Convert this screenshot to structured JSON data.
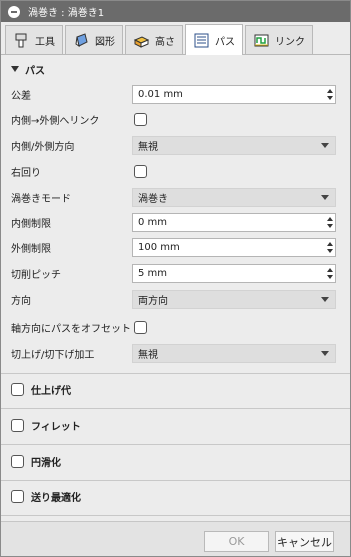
{
  "window": {
    "title": "渦巻き : 渦巻き1"
  },
  "tabs": [
    {
      "label": "工具",
      "icon": "tool-icon"
    },
    {
      "label": "図形",
      "icon": "geometry-icon"
    },
    {
      "label": "高さ",
      "icon": "heights-icon"
    },
    {
      "label": "パス",
      "icon": "passes-icon",
      "active": true
    },
    {
      "label": "リンク",
      "icon": "linking-icon"
    }
  ],
  "passes": {
    "section_label": "パス",
    "tolerance": {
      "label": "公差",
      "value": "0.01 mm"
    },
    "inside_out_link": {
      "label": "内側→外側へリンク",
      "checked": false
    },
    "inside_out_direction": {
      "label": "内側/外側方向",
      "value": "無視"
    },
    "clockwise": {
      "label": "右回り",
      "checked": false
    },
    "spiral_mode": {
      "label": "渦巻きモード",
      "value": "渦巻き"
    },
    "inner_limit": {
      "label": "内側制限",
      "value": "0 mm"
    },
    "outer_limit": {
      "label": "外側制限",
      "value": "100 mm"
    },
    "stepover": {
      "label": "切削ピッチ",
      "value": "5 mm"
    },
    "direction": {
      "label": "方向",
      "value": "両方向"
    },
    "axial_offset": {
      "label": "軸方向にパスをオフセット",
      "checked": false
    },
    "ramp_direction": {
      "label": "切上げ/切下げ加工",
      "value": "無視"
    }
  },
  "groups": [
    {
      "label": "仕上げ代",
      "checked": false
    },
    {
      "label": "フィレット",
      "checked": false
    },
    {
      "label": "円滑化",
      "checked": false
    },
    {
      "label": "送り最適化",
      "checked": false
    }
  ],
  "footer": {
    "ok_label": "OK",
    "cancel_label": "キャンセル"
  }
}
